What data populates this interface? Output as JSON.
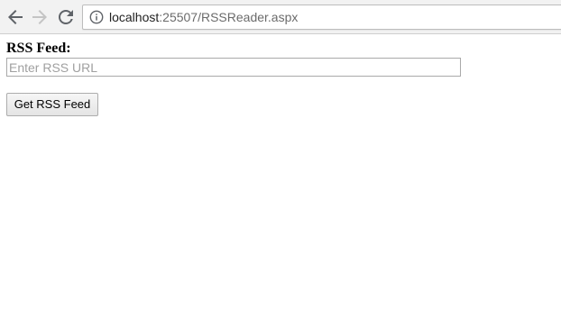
{
  "browser": {
    "address_bar": {
      "host": "localhost",
      "path": ":25507/RSSReader.aspx"
    },
    "icons": {
      "back": "arrow-left-icon",
      "forward": "arrow-right-icon",
      "reload": "reload-icon",
      "site_info": "info-icon"
    }
  },
  "form": {
    "feed_label": "RSS Feed:",
    "url_input": {
      "value": "",
      "placeholder": "Enter RSS URL"
    },
    "submit_label": "Get RSS Feed"
  }
}
